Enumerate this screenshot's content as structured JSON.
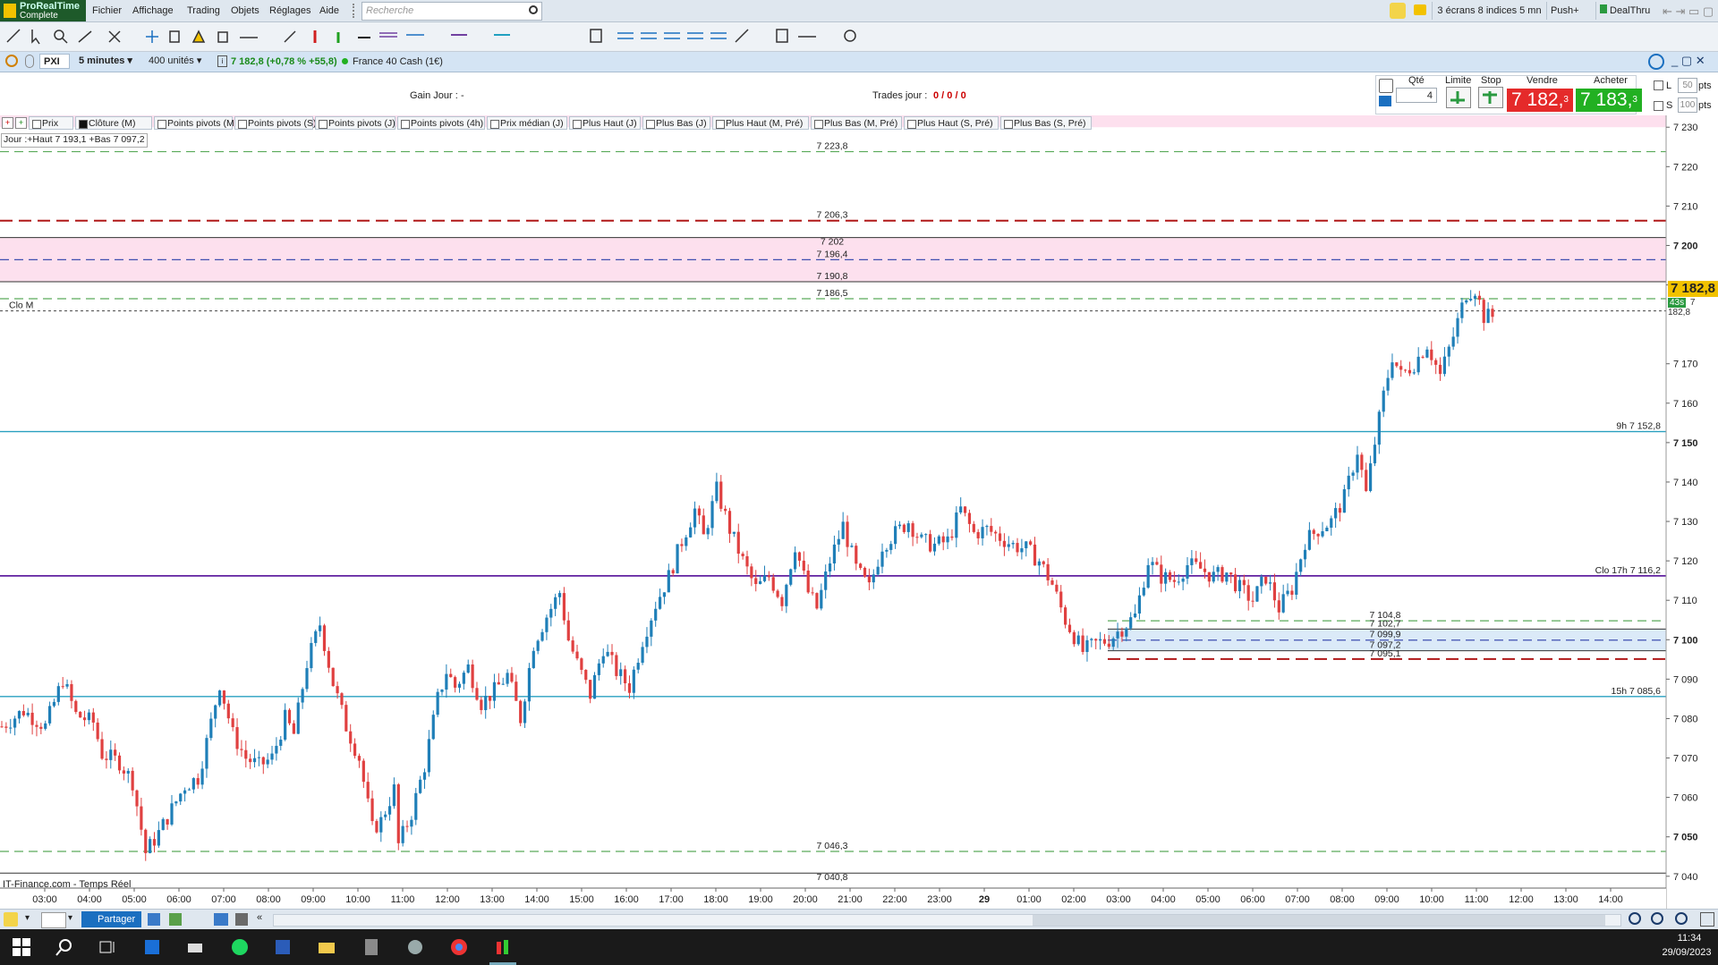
{
  "app": {
    "logo_line1": "ProRealTime",
    "logo_line2": "Complete"
  },
  "menu": [
    "Fichier",
    "Affichage",
    "Trading",
    "Objets",
    "Réglages",
    "Aide"
  ],
  "search": {
    "placeholder": "Recherche"
  },
  "topright": {
    "screens": "3 écrans 8 indices 5 mn",
    "push": "Push+",
    "dealthru": "DealThru"
  },
  "instrument": {
    "ticker": "PXI",
    "timeframe": "5 minutes",
    "units": "400 unités",
    "quote": "7 182,8 (+0,78 % +55,8)",
    "name": "France 40 Cash (1€)"
  },
  "order": {
    "gain_label": "Gain Jour :",
    "gain_value": "-",
    "trades_label": "Trades jour :",
    "trades_value": "0 / 0 / 0",
    "qty_label": "Qté",
    "qty_value": "4",
    "limit_label": "Limite",
    "stop_label": "Stop",
    "sell_label": "Vendre",
    "sell_price": "7 182,",
    "sell_dec": "3",
    "buy_label": "Acheter",
    "buy_price": "7 183,",
    "buy_dec": "3",
    "l_label": "L",
    "l_value": "50",
    "s_label": "S",
    "s_value": "100",
    "pts": "pts",
    "colors": {
      "sell": "#e52a2a",
      "buy": "#22b022"
    }
  },
  "tabs": [
    {
      "label": "Prix",
      "checked": false
    },
    {
      "label": "Clôture (M)",
      "checked": true
    },
    {
      "label": "Points pivots (M)",
      "checked": false
    },
    {
      "label": "Points pivots (S)",
      "checked": false
    },
    {
      "label": "Points pivots (J)",
      "checked": false
    },
    {
      "label": "Points pivots (4h)",
      "checked": false
    },
    {
      "label": "Prix médian (J)",
      "checked": false
    },
    {
      "label": "Plus Haut (J)",
      "checked": false
    },
    {
      "label": "Plus Bas (J)",
      "checked": false
    },
    {
      "label": "Plus Haut (M, Pré)",
      "checked": false
    },
    {
      "label": "Plus Bas (M, Pré)",
      "checked": false
    },
    {
      "label": "Plus Haut (S, Pré)",
      "checked": false
    },
    {
      "label": "Plus Bas (S, Pré)",
      "checked": false
    }
  ],
  "chart_data": {
    "type": "candlestick",
    "ylim": [
      7037,
      7233
    ],
    "yticks": [
      {
        "v": 7230,
        "t": "7 230"
      },
      {
        "v": 7220,
        "t": "7 220"
      },
      {
        "v": 7210,
        "t": "7 210"
      },
      {
        "v": 7200,
        "t": "7 200",
        "bold": true
      },
      {
        "v": 7190,
        "t": "7 190"
      },
      {
        "v": 7170,
        "t": "7 170"
      },
      {
        "v": 7160,
        "t": "7 160"
      },
      {
        "v": 7150,
        "t": "7 150",
        "bold": true
      },
      {
        "v": 7140,
        "t": "7 140"
      },
      {
        "v": 7130,
        "t": "7 130"
      },
      {
        "v": 7120,
        "t": "7 120"
      },
      {
        "v": 7110,
        "t": "7 110"
      },
      {
        "v": 7100,
        "t": "7 100",
        "bold": true
      },
      {
        "v": 7090,
        "t": "7 090"
      },
      {
        "v": 7080,
        "t": "7 080"
      },
      {
        "v": 7070,
        "t": "7 070"
      },
      {
        "v": 7060,
        "t": "7 060"
      },
      {
        "v": 7050,
        "t": "7 050",
        "bold": true
      },
      {
        "v": 7040,
        "t": "7 040"
      }
    ],
    "xticks": [
      "03:00",
      "04:00",
      "05:00",
      "06:00",
      "07:00",
      "08:00",
      "09:00",
      "10:00",
      "11:00",
      "12:00",
      "13:00",
      "14:00",
      "15:00",
      "16:00",
      "17:00",
      "18:00",
      "19:00",
      "20:00",
      "21:00",
      "22:00",
      "23:00",
      "29",
      "01:00",
      "02:00",
      "03:00",
      "04:00",
      "05:00",
      "06:00",
      "07:00",
      "08:00",
      "09:00",
      "10:00",
      "11:00",
      "12:00",
      "13:00",
      "14:00"
    ],
    "candle_path": [
      [
        0,
        7078
      ],
      [
        5,
        7082
      ],
      [
        10,
        7078
      ],
      [
        14,
        7090
      ],
      [
        17,
        7081
      ],
      [
        21,
        7079
      ],
      [
        23,
        7071
      ],
      [
        27,
        7069
      ],
      [
        30,
        7064
      ],
      [
        33,
        7046
      ],
      [
        36,
        7051
      ],
      [
        39,
        7057
      ],
      [
        42,
        7063
      ],
      [
        45,
        7065
      ],
      [
        47,
        7074
      ],
      [
        50,
        7089
      ],
      [
        53,
        7076
      ],
      [
        56,
        7070
      ],
      [
        59,
        7068
      ],
      [
        62,
        7070
      ],
      [
        65,
        7080
      ],
      [
        67,
        7076
      ],
      [
        70,
        7094
      ],
      [
        73,
        7104
      ],
      [
        76,
        7089
      ],
      [
        79,
        7078
      ],
      [
        82,
        7070
      ],
      [
        85,
        7052
      ],
      [
        87,
        7054
      ],
      [
        90,
        7062
      ],
      [
        91,
        7048
      ],
      [
        94,
        7056
      ],
      [
        97,
        7068
      ],
      [
        100,
        7085
      ],
      [
        102,
        7092
      ],
      [
        104,
        7088
      ],
      [
        107,
        7093
      ],
      [
        110,
        7084
      ],
      [
        113,
        7087
      ],
      [
        116,
        7091
      ],
      [
        119,
        7080
      ],
      [
        122,
        7099
      ],
      [
        125,
        7106
      ],
      [
        128,
        7112
      ],
      [
        130,
        7100
      ],
      [
        132,
        7094
      ],
      [
        135,
        7086
      ],
      [
        138,
        7098
      ],
      [
        141,
        7092
      ],
      [
        144,
        7088
      ],
      [
        147,
        7100
      ],
      [
        150,
        7109
      ],
      [
        153,
        7116
      ],
      [
        156,
        7125
      ],
      [
        159,
        7133
      ],
      [
        161,
        7126
      ],
      [
        164,
        7138
      ],
      [
        167,
        7128
      ],
      [
        170,
        7120
      ],
      [
        173,
        7113
      ],
      [
        176,
        7116
      ],
      [
        179,
        7110
      ],
      [
        182,
        7124
      ],
      [
        185,
        7112
      ],
      [
        187,
        7108
      ],
      [
        190,
        7120
      ],
      [
        193,
        7129
      ],
      [
        196,
        7118
      ],
      [
        199,
        7113
      ],
      [
        202,
        7124
      ],
      [
        205,
        7127
      ],
      [
        208,
        7130
      ],
      [
        211,
        7125
      ],
      [
        214,
        7124
      ],
      [
        217,
        7125
      ],
      [
        220,
        7133
      ],
      [
        223,
        7127
      ],
      [
        226,
        7128
      ],
      [
        229,
        7126
      ],
      [
        232,
        7124
      ],
      [
        235,
        7123
      ],
      [
        238,
        7120
      ],
      [
        241,
        7114
      ],
      [
        244,
        7105
      ],
      [
        246,
        7101
      ],
      [
        248,
        7097
      ],
      [
        251,
        7099
      ],
      [
        254,
        7100
      ],
      [
        257,
        7103
      ],
      [
        260,
        7106
      ],
      [
        263,
        7120
      ],
      [
        266,
        7116
      ],
      [
        269,
        7115
      ],
      [
        272,
        7119
      ],
      [
        275,
        7118
      ],
      [
        278,
        7116
      ],
      [
        281,
        7117
      ],
      [
        284,
        7113
      ],
      [
        287,
        7110
      ],
      [
        290,
        7116
      ],
      [
        293,
        7108
      ],
      [
        296,
        7113
      ],
      [
        299,
        7125
      ],
      [
        302,
        7128
      ],
      [
        305,
        7130
      ],
      [
        308,
        7136
      ],
      [
        311,
        7148
      ],
      [
        313,
        7137
      ],
      [
        315,
        7150
      ],
      [
        317,
        7162
      ],
      [
        319,
        7172
      ],
      [
        321,
        7167
      ],
      [
        324,
        7170
      ],
      [
        327,
        7175
      ],
      [
        330,
        7167
      ],
      [
        333,
        7177
      ],
      [
        336,
        7188
      ],
      [
        338,
        7189
      ],
      [
        340,
        7182
      ],
      [
        342,
        7182
      ]
    ],
    "levels": [
      {
        "v": 7223.8,
        "label": "7 223,8",
        "style": "green-dash",
        "pos": "mid"
      },
      {
        "v": 7206.3,
        "label": "7 206,3",
        "style": "red-dash",
        "pos": "mid"
      },
      {
        "v": 7202,
        "label": "7 202",
        "style": "black",
        "pos": "mid"
      },
      {
        "v": 7196.4,
        "label": "7 196,4",
        "style": "blue-dash",
        "pos": "mid"
      },
      {
        "v": 7190.8,
        "label": "7 190,8",
        "style": "black",
        "pos": "mid"
      },
      {
        "v": 7186.5,
        "label": "7 186,5",
        "style": "green-dash",
        "pos": "mid"
      },
      {
        "v": 7183.4,
        "label": "Clo M",
        "style": "black-dot",
        "pos": "left"
      },
      {
        "v": 7152.8,
        "label": "9h 7 152,8",
        "style": "cyan",
        "pos": "right"
      },
      {
        "v": 7116.2,
        "label": "Clo 17h 7 116,2",
        "style": "purple",
        "pos": "right"
      },
      {
        "v": 7104.8,
        "label": "7 104,8",
        "style": "green-dash-short",
        "pos": "right2"
      },
      {
        "v": 7102.7,
        "label": "7 102,7",
        "style": "black-short",
        "pos": "right2"
      },
      {
        "v": 7099.9,
        "label": "7 099,9",
        "style": "blue-dash-short",
        "pos": "right2"
      },
      {
        "v": 7097.2,
        "label": "7 097,2",
        "style": "black-short",
        "pos": "right2"
      },
      {
        "v": 7095.1,
        "label": "7 095,1",
        "style": "red-dash-short",
        "pos": "right2"
      },
      {
        "v": 7085.6,
        "label": "15h 7 085,6",
        "style": "cyan",
        "pos": "right"
      },
      {
        "v": 7046.3,
        "label": "7 046,3",
        "style": "green-dash",
        "pos": "mid"
      },
      {
        "v": 7040.8,
        "label": "7 040,8",
        "style": "black",
        "pos": "mid"
      }
    ],
    "bands": [
      {
        "from": 7190.8,
        "to": 7202,
        "color": "#fde0ee"
      },
      {
        "from": 7230,
        "to": 7233,
        "color": "#fde0ee"
      },
      {
        "from": 7097.2,
        "to": 7102.7,
        "color": "#dbeaf8"
      }
    ],
    "info_text": "Jour :+Haut 7 193,1 +Bas 7 097,2",
    "current_price": "7 182,8",
    "current_price_small": "7 182,8",
    "timer": "43s",
    "source": "IT-Finance.com - Temps Réel",
    "colors": {
      "up": "#1f7fb8",
      "down": "#e04040"
    }
  },
  "bottom": {
    "share": "Partager"
  },
  "taskbar": {
    "time": "11:34",
    "date": "29/09/2023"
  }
}
